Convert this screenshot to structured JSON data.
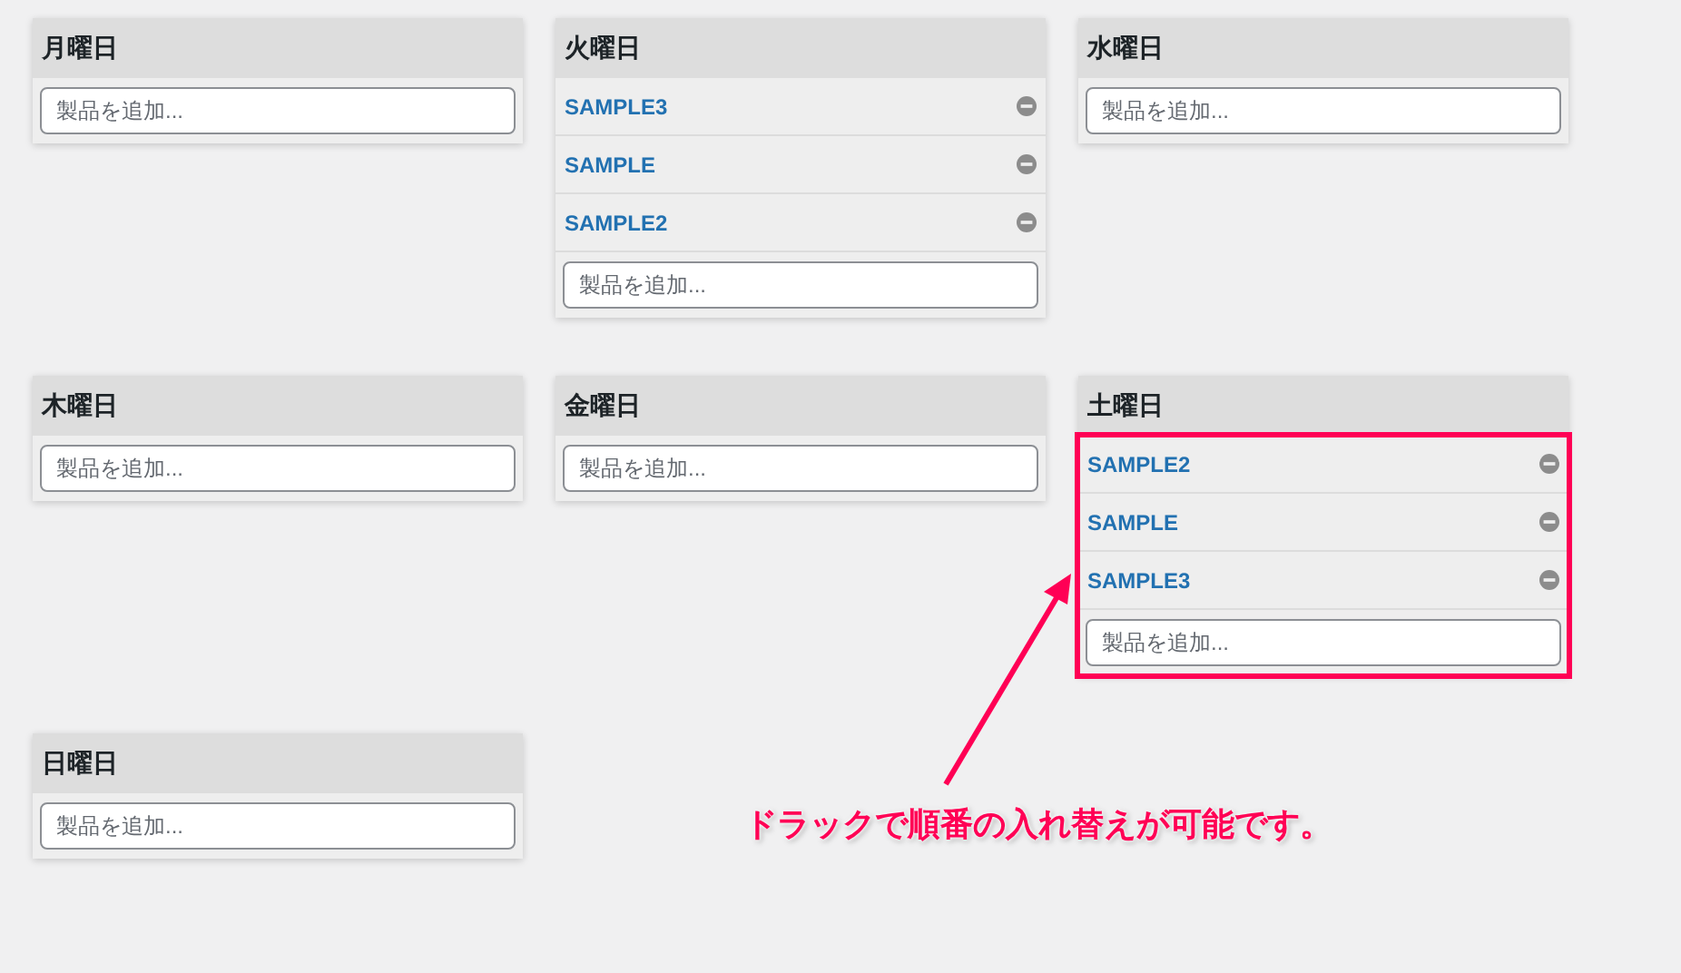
{
  "days": [
    {
      "title": "月曜日",
      "highlighted": false,
      "input": {
        "placeholder": "製品を追加..."
      }
    },
    {
      "title": "火曜日",
      "highlighted": false,
      "items": [
        "SAMPLE3",
        "SAMPLE",
        "SAMPLE2"
      ],
      "input": {
        "placeholder": "製品を追加..."
      }
    },
    {
      "title": "水曜日",
      "highlighted": false,
      "input": {
        "placeholder": "製品を追加..."
      }
    },
    {
      "title": "木曜日",
      "highlighted": false,
      "input": {
        "placeholder": "製品を追加..."
      }
    },
    {
      "title": "金曜日",
      "highlighted": false,
      "input": {
        "placeholder": "製品を追加..."
      }
    },
    {
      "title": "土曜日",
      "highlighted": true,
      "items": [
        "SAMPLE2",
        "SAMPLE",
        "SAMPLE3"
      ],
      "input": {
        "placeholder": "製品を追加..."
      }
    },
    {
      "title": "日曜日",
      "highlighted": false,
      "input": {
        "placeholder": "製品を追加..."
      }
    }
  ],
  "annotation": {
    "text": "ドラックで順番の入れ替えが可能です。"
  }
}
